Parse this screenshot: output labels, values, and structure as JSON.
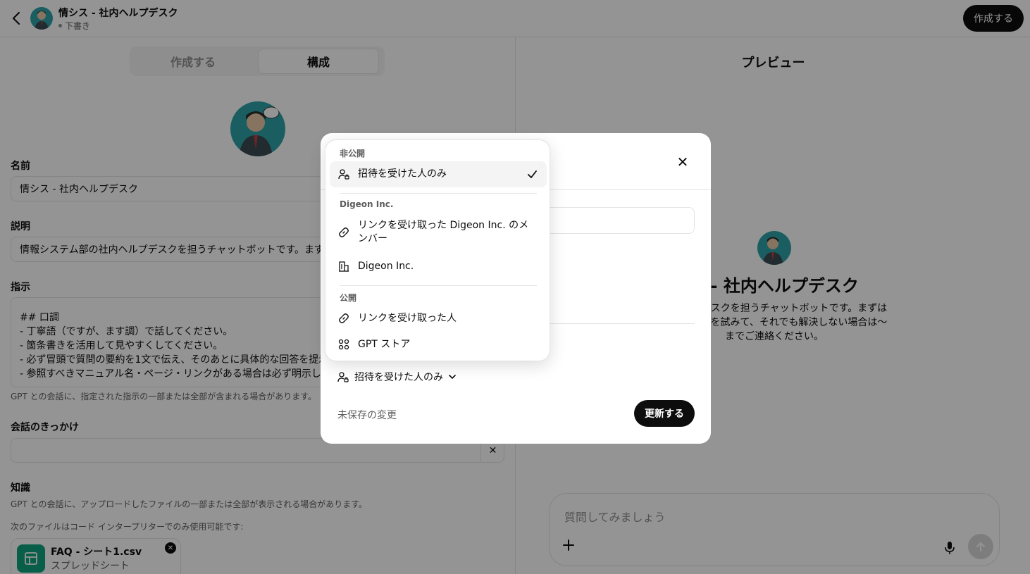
{
  "header": {
    "title": "情シス - 社内ヘルプデスク",
    "status": "下書き",
    "create_label": "作成する"
  },
  "tabs": {
    "create": "作成する",
    "configure": "構成"
  },
  "form": {
    "name_label": "名前",
    "name_value": "情シス - 社内ヘルプデスク",
    "description_label": "説明",
    "description_value": "情報システム部の社内ヘルプデスクを担うチャットボットです。まず",
    "instructions_label": "指示",
    "instructions_value": "## 口調\n- 丁寧語（ですが、ます調）で話してください。\n- 箇条書きを活用して見やすくしてください。\n- 必ず冒頭で質問の要約を1文で伝え、そのあとに具体的な回答を提示\n- 参照すべきマニュアル名・ページ・リンクがある場合は必ず明示し",
    "instructions_hint": "GPT との会話に、指定された指示の一部または全部が含まれる場合があります。",
    "starters_label": "会話のきっかけ",
    "knowledge_label": "知識",
    "knowledge_hint": "GPT との会話に、アップロードしたファイルの一部または全部が表示される場合があります。",
    "interpreter_hint": "次のファイルはコード インタープリターでのみ使用可能です:",
    "file_name": "FAQ - シート1.csv",
    "file_type": "スプレッドシート"
  },
  "preview": {
    "title": "プレビュー",
    "gpt_name": "ス - 社内ヘルプデスク",
    "desc_line1": "内ヘルプデスクを担うチャットボットです。まずは",
    "desc_line2": "で自己解決を試みて、それでも解決しない場合は〜",
    "desc_line3": "までご連絡ください。",
    "composer_placeholder": "質問してみましょう"
  },
  "modal": {
    "access_value": "招待を受けた人のみ",
    "unsaved": "未保存の変更",
    "update_label": "更新する"
  },
  "dropdown": {
    "private_group": "非公開",
    "private_option": "招待を受けた人のみ",
    "org_group": "Digeon Inc.",
    "org_link_option": "リンクを受け取った Digeon Inc. のメンバー",
    "org_option": "Digeon Inc.",
    "public_group": "公開",
    "public_link_option": "リンクを受け取った人",
    "store_option": "GPT ストア",
    "selected": "招待を受けた人のみ"
  },
  "icons": {
    "back": "chevron-left-icon",
    "close": "close-icon",
    "person_lock": "person-lock-icon",
    "link": "link-icon",
    "building": "building-icon",
    "grid": "apps-grid-icon",
    "check": "check-icon",
    "plus": "plus-icon",
    "mic": "microphone-icon",
    "send": "arrow-up-icon",
    "spreadsheet": "spreadsheet-icon"
  },
  "colors": {
    "primary_button": "#0d0d0d",
    "file_icon_bg": "#10a37f",
    "avatar_bg": "#2fa3a8"
  }
}
